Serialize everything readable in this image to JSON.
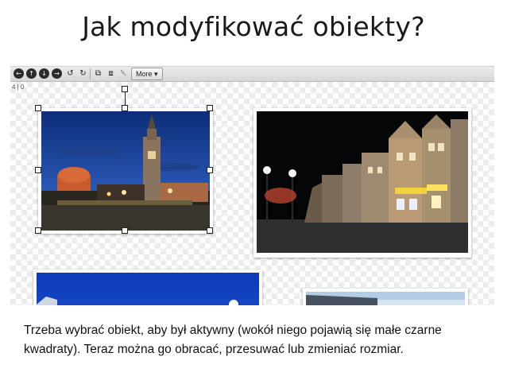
{
  "slide": {
    "title": "Jak modyfikować obiekty?",
    "caption": "Trzeba wybrać obiekt, aby był aktywny (wokół niego pojawią się małe czarne kwadraty). Teraz można go obracać, przesuwać lub zmieniać rozmiar."
  },
  "toolbar": {
    "buttons": [
      {
        "name": "move-left-icon",
        "glyph": "←"
      },
      {
        "name": "move-up-icon",
        "glyph": "↑"
      },
      {
        "name": "move-down-icon",
        "glyph": "↓"
      },
      {
        "name": "move-right-icon",
        "glyph": "→"
      },
      {
        "name": "rotate-left-icon",
        "glyph": "↺"
      },
      {
        "name": "rotate-right-icon",
        "glyph": "↻"
      },
      {
        "name": "bring-front-icon",
        "glyph": "⧉"
      },
      {
        "name": "send-back-icon",
        "glyph": "⧈"
      },
      {
        "name": "trash-icon",
        "glyph": "␡"
      }
    ],
    "more_label": "More ▾"
  },
  "canvas": {
    "counter": "4 | 0",
    "photos": [
      "town-hall-night",
      "market-square-night",
      "blue-sky-photo",
      "street-photo"
    ],
    "selected_photo": "town-hall-night"
  }
}
